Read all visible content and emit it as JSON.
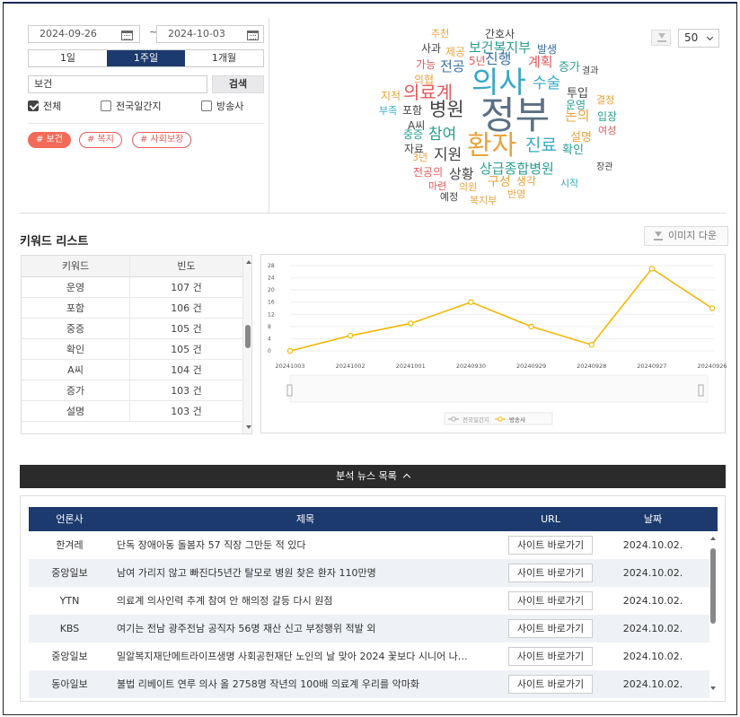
{
  "filter": {
    "start_date": "2024-09-26",
    "end_date": "2024-10-03",
    "tilde": "~",
    "periods": [
      "1일",
      "1주일",
      "1개월"
    ],
    "active_period": "1주일",
    "search_value": "보건",
    "search_button": "검색",
    "checks": [
      {
        "label": "전체",
        "checked": true
      },
      {
        "label": "전국일간지",
        "checked": false
      },
      {
        "label": "방송사",
        "checked": false
      }
    ],
    "tags": [
      "# 보건",
      "# 복지",
      "# 사회보장"
    ]
  },
  "cloud": {
    "count_select": "50",
    "words": [
      {
        "text": "추천",
        "color": "#e8a33c"
      },
      {
        "text": "간호사",
        "color": "#444444"
      },
      {
        "text": "사과",
        "color": "#444444"
      },
      {
        "text": "제공",
        "color": "#e8a33c"
      },
      {
        "text": "보건복지부",
        "color": "#2a9d8f"
      },
      {
        "text": "발생",
        "color": "#3a6ea5"
      },
      {
        "text": "전공",
        "color": "#3a6ea5"
      },
      {
        "text": "가능",
        "color": "#e05a5a"
      },
      {
        "text": "5년",
        "color": "#e05a5a"
      },
      {
        "text": "진행",
        "color": "#3a6ea5"
      },
      {
        "text": "계획",
        "color": "#e05a5a"
      },
      {
        "text": "증가",
        "color": "#2a9d8f"
      },
      {
        "text": "결과",
        "color": "#444444"
      },
      {
        "text": "의협",
        "color": "#e8a33c"
      },
      {
        "text": "의사",
        "color": "#36a9c6"
      },
      {
        "text": "수술",
        "color": "#36a9c6"
      },
      {
        "text": "지적",
        "color": "#e8a33c"
      },
      {
        "text": "의료계",
        "color": "#e05a5a"
      },
      {
        "text": "투입",
        "color": "#444444"
      },
      {
        "text": "결정",
        "color": "#e8a33c"
      },
      {
        "text": "운영",
        "color": "#2a9d8f"
      },
      {
        "text": "부족",
        "color": "#36a9c6"
      },
      {
        "text": "포함",
        "color": "#444444"
      },
      {
        "text": "병원",
        "color": "#444444"
      },
      {
        "text": "정부",
        "color": "#5b7083"
      },
      {
        "text": "논의",
        "color": "#e8a33c"
      },
      {
        "text": "입장",
        "color": "#2a9d8f"
      },
      {
        "text": "A씨",
        "color": "#444444"
      },
      {
        "text": "중증",
        "color": "#2a9d8f"
      },
      {
        "text": "참여",
        "color": "#2a9d8f"
      },
      {
        "text": "여성",
        "color": "#e05a5a"
      },
      {
        "text": "설명",
        "color": "#e8a33c"
      },
      {
        "text": "자료",
        "color": "#444444"
      },
      {
        "text": "환자",
        "color": "#e8a33c"
      },
      {
        "text": "진료",
        "color": "#36a9c6"
      },
      {
        "text": "확인",
        "color": "#2a9d8f"
      },
      {
        "text": "3년",
        "color": "#e8a33c"
      },
      {
        "text": "지원",
        "color": "#444444"
      },
      {
        "text": "전공의",
        "color": "#e05a5a"
      },
      {
        "text": "상황",
        "color": "#444444"
      },
      {
        "text": "상급종합병원",
        "color": "#2a9d8f"
      },
      {
        "text": "장관",
        "color": "#444444"
      },
      {
        "text": "마련",
        "color": "#e05a5a"
      },
      {
        "text": "의원",
        "color": "#e8a33c"
      },
      {
        "text": "구성",
        "color": "#e8a33c"
      },
      {
        "text": "생각",
        "color": "#e8a33c"
      },
      {
        "text": "시작",
        "color": "#36a9c6"
      },
      {
        "text": "예정",
        "color": "#444444"
      },
      {
        "text": "복지부",
        "color": "#e8a33c"
      },
      {
        "text": "반영",
        "color": "#e8a33c"
      }
    ]
  },
  "keywords": {
    "title": "키워드 리스트",
    "image_download": "이미지 다운",
    "headers": [
      "키워드",
      "빈도"
    ],
    "rows": [
      [
        "운영",
        "107 건"
      ],
      [
        "포함",
        "106 건"
      ],
      [
        "중증",
        "105 건"
      ],
      [
        "확인",
        "105 건"
      ],
      [
        "A씨",
        "104 건"
      ],
      [
        "증가",
        "103 건"
      ],
      [
        "설명",
        "103 건"
      ]
    ]
  },
  "chart_data": {
    "type": "line",
    "title": "",
    "xlabel": "",
    "ylabel": "",
    "categories": [
      "20241003",
      "20241002",
      "20241001",
      "20240930",
      "20240929",
      "20240928",
      "20240927",
      "20240926"
    ],
    "yticks": [
      0,
      4,
      8,
      12,
      16,
      20,
      24,
      28
    ],
    "ylim": [
      0,
      28
    ],
    "series": [
      {
        "name": "전국일간지",
        "values": [],
        "color": "#aaaaaa"
      },
      {
        "name": "방송사",
        "values": [
          0,
          5,
          9,
          16,
          8,
          2,
          27,
          14
        ],
        "color": "#f2b705"
      }
    ],
    "legend": "bottom"
  },
  "news": {
    "toggle_label": "분석 뉴스 목록",
    "headers": [
      "언론사",
      "제목",
      "URL",
      "날짜"
    ],
    "link_label": "사이트 바로가기",
    "rows": [
      [
        "한겨레",
        "단독 장애아동 돌봄자 57 직장 그만둔 적 있다",
        "2024.10.02."
      ],
      [
        "중앙일보",
        "남여 가리지 않고 빠진다5년간 탈모로 병원 찾은 환자 110만명",
        "2024.10.02."
      ],
      [
        "YTN",
        "의료계 의사인력 추계 참여 안 해의정 갈등 다시 원점",
        "2024.10.02."
      ],
      [
        "KBS",
        "여기는 전남 광주전남 공직자 56명 재산 신고 부정행위 적발 외",
        "2024.10.02."
      ],
      [
        "중앙일보",
        "밀알복지재단메트라이프생명 사회공헌재단 노인의 날 맞아 2024 꽃보다 시니어 나…",
        "2024.10.02."
      ],
      [
        "동아일보",
        "불법 리베이트 연루 의사 올 2758명 작년의 100배 의료계 우리를 악마화",
        "2024.10.02."
      ]
    ]
  }
}
